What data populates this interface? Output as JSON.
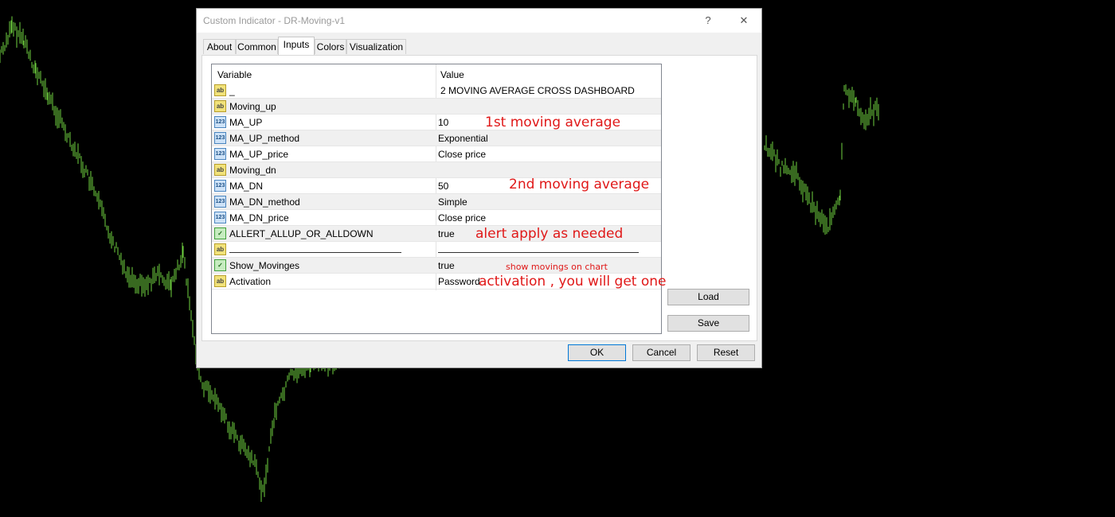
{
  "dialog": {
    "title": "Custom Indicator - DR-Moving-v1",
    "help_glyph": "?",
    "close_glyph": "✕"
  },
  "tabs": [
    "About",
    "Common",
    "Inputs",
    "Colors",
    "Visualization"
  ],
  "active_tab": "Inputs",
  "grid": {
    "col_variable": "Variable",
    "col_value": "Value",
    "rows": [
      {
        "icon": "ab",
        "variable": "_",
        "value": "2 MOVING AVERAGE CROSS DASHBOARD"
      },
      {
        "icon": "ab",
        "variable": "Moving_up",
        "value": ""
      },
      {
        "icon": "123",
        "variable": "MA_UP",
        "value": "10"
      },
      {
        "icon": "123",
        "variable": "MA_UP_method",
        "value": "Exponential"
      },
      {
        "icon": "123",
        "variable": "MA_UP_price",
        "value": "Close price"
      },
      {
        "icon": "ab",
        "variable": "Moving_dn",
        "value": ""
      },
      {
        "icon": "123",
        "variable": "MA_DN",
        "value": "50"
      },
      {
        "icon": "123",
        "variable": "MA_DN_method",
        "value": "Simple"
      },
      {
        "icon": "123",
        "variable": "MA_DN_price",
        "value": "Close price"
      },
      {
        "icon": "bool",
        "variable": "ALLERT_ALLUP_OR_ALLDOWN",
        "value": "true"
      },
      {
        "icon": "ab",
        "variable": "",
        "value": ""
      },
      {
        "icon": "bool",
        "variable": "Show_Movinges",
        "value": "true"
      },
      {
        "icon": "ab",
        "variable": "Activation",
        "value": "Password"
      }
    ]
  },
  "annotations": {
    "first": "1st moving average",
    "second": "2nd moving average",
    "alert": "alert apply as needed",
    "show": "show movings on chart",
    "activation": "activation , you will get one"
  },
  "buttons": {
    "load": "Load",
    "save": "Save",
    "ok": "OK",
    "cancel": "Cancel",
    "reset": "Reset"
  },
  "colors": {
    "chart_bars": "#6fd23f",
    "annotation": "#e01818",
    "background": "#000000"
  }
}
